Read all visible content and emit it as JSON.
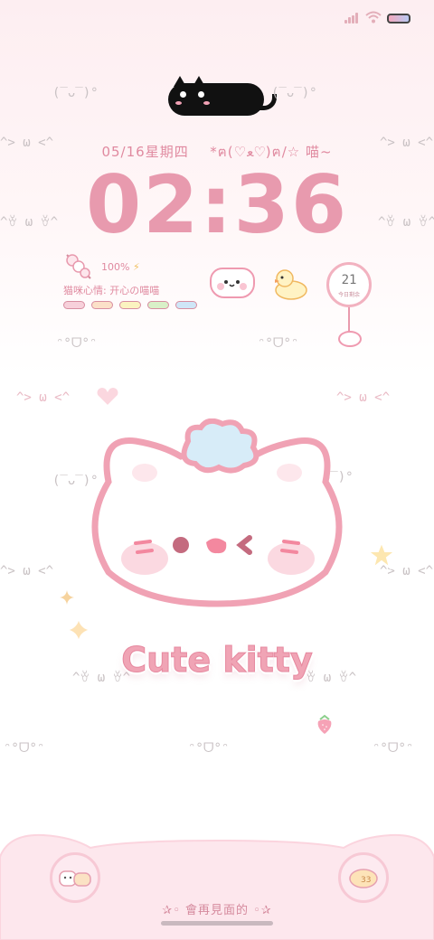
{
  "status_bar": {
    "signal_icon": "cellular-signal-icon",
    "wifi_icon": "wifi-icon",
    "battery_icon": "battery-icon",
    "battery_level": 1.0
  },
  "lock_screen": {
    "date_text": "05/16星期四",
    "kaomoji_header": "*ฅ(♡ﻌ♡)ฅ/☆ 喵~",
    "time": "02:36"
  },
  "widgets": {
    "battery_text": "100%",
    "mood_text": "猫咪心情: 开心の喵喵",
    "mood_pill_colors": [
      "#f7d0da",
      "#fbe0c8",
      "#fbf3c0",
      "#d9f0c8",
      "#cfe6f7"
    ],
    "calendar_day": "21",
    "calendar_label": "今日剩余"
  },
  "decor": {
    "kaomoji_1": "(‾ᴗ‾)°",
    "kaomoji_2": "^> ω <^",
    "kaomoji_3": "^ꈊ ω ꈊ^",
    "kaomoji_4": "ᵔ°ᗜ°ᵔ",
    "title": "Cute kitty"
  },
  "dock": {
    "bye_text": "✰◦ 會再見面的 ◦✰"
  },
  "colors": {
    "accent_pink": "#e89aae",
    "text_pink": "#e08aa0",
    "background_top": "#fdeef1"
  }
}
